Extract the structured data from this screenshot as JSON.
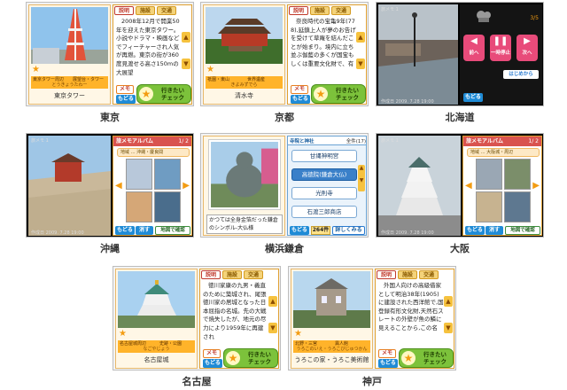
{
  "ui": {
    "tab_labels": [
      "説明",
      "施設",
      "交通"
    ],
    "memo": "メモ",
    "back": "もどる",
    "wish_line1": "行きたい",
    "wish_line2": "チェック",
    "album_title": "旅メモアルバム",
    "album_page": "1/ 2",
    "delete": "消す",
    "map_check": "地図で確認",
    "viewer_prev": "前へ",
    "viewer_pause": "一時停止",
    "viewer_next": "次へ",
    "viewer_start": "はじめから",
    "viewer_counter": "3/5",
    "hud_label": "旅メモ 1",
    "hud_date": "作成日 2009. 7.28   19:00",
    "list_detail": "詳しくみる",
    "list_count": "264件"
  },
  "cards": [
    {
      "caption": "東京",
      "name": "東京タワー",
      "kana": "とうきょうたわー",
      "tag1": "東京タワー周辺",
      "tag2": "展望台・タワー",
      "description": "2008年12月で開業50年を迎えた東京タワー。小説やドラマ・映画などでフィーチャーされ人気が再燃。東京の街が360度見渡せる高さ150mの大展望"
    },
    {
      "caption": "京都",
      "name": "清水寺",
      "kana": "きよみずでら",
      "tag1": "祇園・東山",
      "tag2": "世界遺産",
      "description": "奈良時代の宝亀9年(778),延鎮上人が夢のお告げを受けて草庵を結んだことが始まり。境内に立ち並ぶ伽藍の多くが国宝もしくは重要文化財で、有"
    },
    {
      "caption": "北海道"
    },
    {
      "caption": "沖縄",
      "album_sub": "地域 … 沖縄・慶良間"
    },
    {
      "caption": "横浜鎌倉",
      "list_header": "寺院と神社",
      "list_region": "全件(17)",
      "list_items": [
        "甘縄神明宮",
        "高徳院(鎌倉大仏)",
        "光則寺",
        "石渡三郎商店"
      ],
      "photo_text": "かつては全身金箔だった鎌倉のシンボル-大仏様"
    },
    {
      "caption": "大阪",
      "album_sub": "地域 … 大阪城・周辺"
    },
    {
      "caption": "名古屋",
      "name": "名古屋城",
      "kana": "なごやじょう",
      "tag1": "名古屋城周辺",
      "tag2": "史跡・公園",
      "description": "徳川家康の九男・義直のために築城され、尾張徳川家の居城となった日本屈指の名城。先の大戦で焼失したが、地元の尽力により1959年に再建され"
    },
    {
      "caption": "神戸",
      "name": "うろこの家・うろこ美術館",
      "kana": "うろこのいえ・うろこびじゅつかん",
      "tag1": "北野・三宮",
      "tag2": "異人館",
      "description": "外国人向けの高級借家として明治38年(1905)に建設された西洋館で,国登録有形文化財,天然石スレートの外壁が魚の鱗に見えることから,この名"
    }
  ]
}
